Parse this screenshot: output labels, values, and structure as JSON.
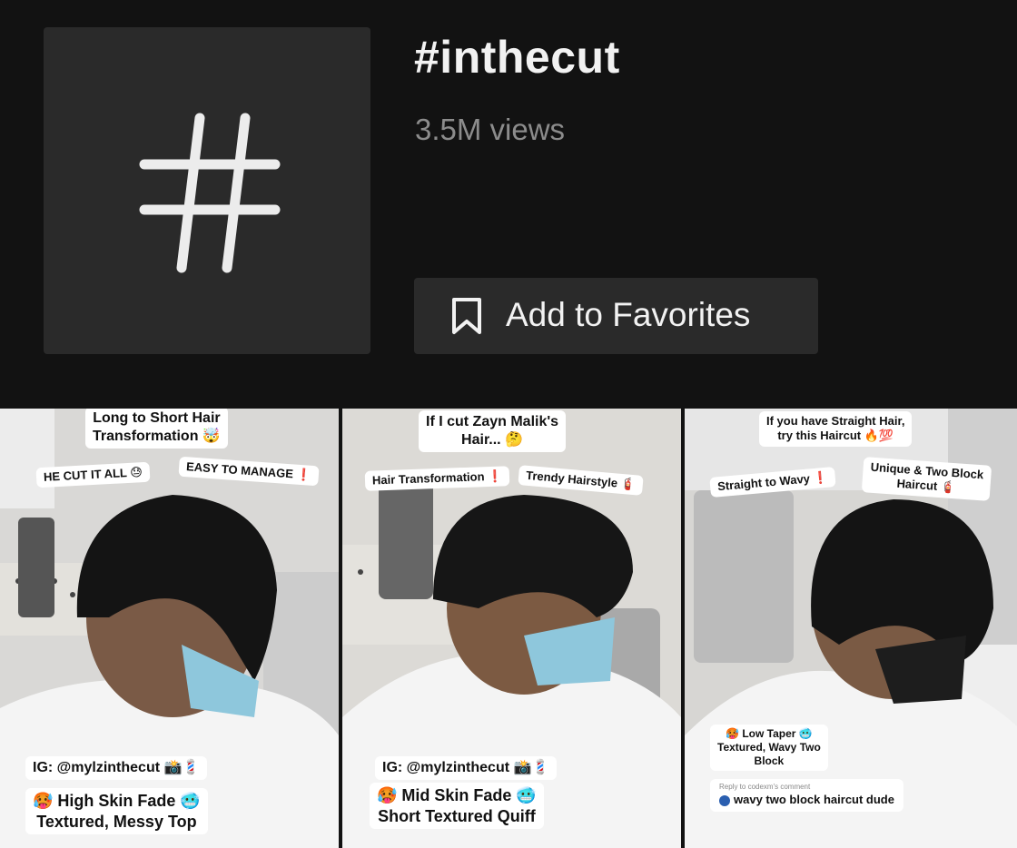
{
  "header": {
    "hashtag_symbol": "#",
    "title": "#inthecut",
    "views": "3.5M views",
    "favorite_button": {
      "label": "Add to Favorites",
      "icon": "bookmark-icon"
    }
  },
  "videos": [
    {
      "captions": {
        "top": "Long to Short Hair\nTransformation 🤯",
        "left_tag": "HE CUT IT ALL 😓",
        "right_tag": "EASY TO MANAGE ❗",
        "ig": "IG: @mylzinthecut 📸💈",
        "style": "🥵 High Skin Fade 🥶\nTextured, Messy Top"
      }
    },
    {
      "captions": {
        "top": "If I cut Zayn Malik's\nHair... 🤔",
        "left_tag": "Hair Transformation ❗",
        "right_tag": "Trendy Hairstyle 🧯",
        "ig": "IG: @mylzinthecut 📸💈",
        "style": "🥵 Mid Skin Fade 🥶\nShort Textured Quiff"
      }
    },
    {
      "captions": {
        "top": "If you have Straight Hair,\ntry this Haircut 🔥💯",
        "left_tag": "Straight to Wavy ❗",
        "right_tag": "Unique & Two Block\nHaircut 🧯",
        "style": "🥵 Low Taper 🥶\nTextured, Wavy Two\nBlock",
        "reply_header": "Reply to codexm's comment",
        "reply_text": "wavy two block haircut dude"
      }
    }
  ]
}
